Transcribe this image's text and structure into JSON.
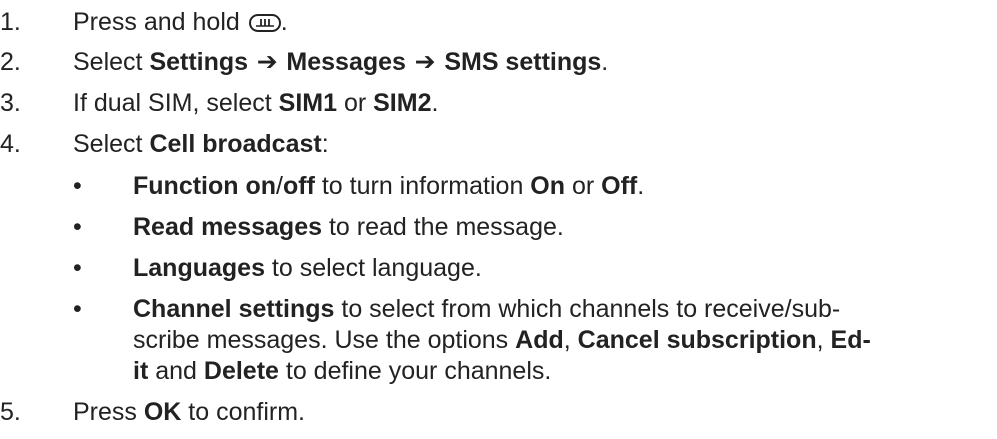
{
  "steps": [
    {
      "num": "1.",
      "pre": "Press and hold ",
      "icon": "menu-key-icon",
      "post": "."
    },
    {
      "num": "2.",
      "pre": "Select ",
      "b1": "Settings",
      "arrow1": " ➔ ",
      "b2": "Messages",
      "arrow2": " ➔ ",
      "b3": "SMS settings",
      "post": "."
    },
    {
      "num": "3.",
      "pre": "If dual SIM, select ",
      "b1": "SIM1",
      "mid": " or ",
      "b2": "SIM2",
      "post": "."
    },
    {
      "num": "4.",
      "pre": "Select ",
      "b1": "Cell broadcast",
      "post": ":"
    },
    {
      "num": "5.",
      "pre": "Press ",
      "b1": "OK",
      "post": " to confirm."
    }
  ],
  "bullets": [
    {
      "mark": "•",
      "b1": "Function on",
      "slash": "/",
      "b2": "off",
      "t1": " to turn information ",
      "b3": "On",
      "t2": " or ",
      "b4": "Off",
      "t3": "."
    },
    {
      "mark": "•",
      "b1": "Read messages",
      "t1": " to read the message."
    },
    {
      "mark": "•",
      "b1": "Languages",
      "t1": " to select language."
    },
    {
      "mark": "•",
      "b1": "Channel settings",
      "t1": " to select from which channels to receive/sub-",
      "line2_t1": "scribe messages. Use the options ",
      "line2_b1": "Add",
      "line2_t2": ", ",
      "line2_b2": "Cancel subscription",
      "line2_t3": ", ",
      "line2_b3": "Ed-",
      "line3_b1": "it",
      "line3_t1": " and ",
      "line3_b2": "Delete",
      "line3_t2": " to define your channels."
    }
  ]
}
